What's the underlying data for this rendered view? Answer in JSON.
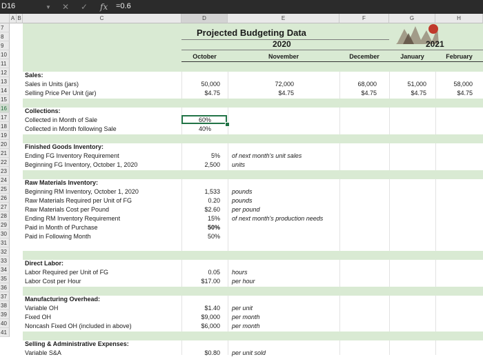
{
  "formula_bar": {
    "cell_ref": "D16",
    "cancel_icon": "✕",
    "confirm_icon": "✓",
    "fx_label": "fx",
    "formula": "=0.6"
  },
  "columns": [
    "A",
    "B",
    "C",
    "D",
    "E",
    "F",
    "G",
    "H"
  ],
  "rows": [
    "7",
    "8",
    "9",
    "10",
    "11",
    "12",
    "13",
    "14",
    "15",
    "16",
    "17",
    "18",
    "19",
    "20",
    "21",
    "22",
    "23",
    "24",
    "25",
    "26",
    "27",
    "28",
    "29",
    "30",
    "31",
    "32",
    "33",
    "34",
    "35",
    "36",
    "37",
    "38",
    "39",
    "40",
    "41"
  ],
  "header": {
    "title": "Projected Budgeting Data",
    "year_2020": "2020",
    "year_2021": "2021",
    "months": {
      "october": "October",
      "november": "November",
      "december": "December",
      "january": "January",
      "february": "February"
    }
  },
  "sales": {
    "heading": "Sales:",
    "units_label": "Sales in Units (jars)",
    "units": {
      "oct": "50,000",
      "nov": "72,000",
      "dec": "68,000",
      "jan": "51,000",
      "feb": "58,000"
    },
    "price_label": "Selling Price Per Unit (jar)",
    "price": {
      "oct": "$4.75",
      "nov": "$4.75",
      "dec": "$4.75",
      "jan": "$4.75",
      "feb": "$4.75"
    }
  },
  "collections": {
    "heading": "Collections:",
    "month_of_sale_label": "Collected in Month of Sale",
    "month_of_sale": "60%",
    "following_label": "Collected in Month following Sale",
    "following": "40%"
  },
  "finished_goods": {
    "heading": "Finished Goods Inventory:",
    "ending_label": "Ending FG Inventory Requirement",
    "ending": "5%",
    "ending_note": "of next month's unit sales",
    "beginning_label": "Beginning FG Inventory, October 1, 2020",
    "beginning": "2,500",
    "beginning_note": "units"
  },
  "raw_materials": {
    "heading": "Raw Materials Inventory:",
    "beginning_label": "Beginning RM Inventory, October 1, 2020",
    "beginning": "1,533",
    "beginning_note": "pounds",
    "required_label": "Raw Materials Required per Unit of FG",
    "required": "0.20",
    "required_note": "pounds",
    "cost_label": "Raw Materials Cost per Pound",
    "cost": "$2.60",
    "cost_note": "per pound",
    "ending_label": "Ending RM Inventory Requirement",
    "ending": "15%",
    "ending_note": "of next month's production needs",
    "paid_month_label": "Paid in Month of Purchase",
    "paid_month": "50%",
    "paid_following_label": "Paid in Following Month",
    "paid_following": "50%"
  },
  "direct_labor": {
    "heading": "Direct Labor:",
    "required_label": "Labor Required per Unit of FG",
    "required": "0.05",
    "required_note": "hours",
    "cost_label": "Labor Cost per Hour",
    "cost": "$17.00",
    "cost_note": "per hour"
  },
  "overhead": {
    "heading": "Manufacturing Overhead:",
    "variable_label": "Variable OH",
    "variable": "$1.40",
    "variable_note": "per unit",
    "fixed_label": "Fixed OH",
    "fixed": "$9,000",
    "fixed_note": "per month",
    "noncash_label": "Noncash Fixed OH (included in above)",
    "noncash": "$6,000",
    "noncash_note": "per month"
  },
  "selling_admin": {
    "heading": "Selling & Administrative Expenses:",
    "variable_label": "Variable S&A",
    "variable": "$0.80",
    "variable_note": "per unit sold"
  },
  "colors": {
    "band": "#d9ead3",
    "selection": "#217346",
    "header_bg": "#e9e9e9"
  }
}
